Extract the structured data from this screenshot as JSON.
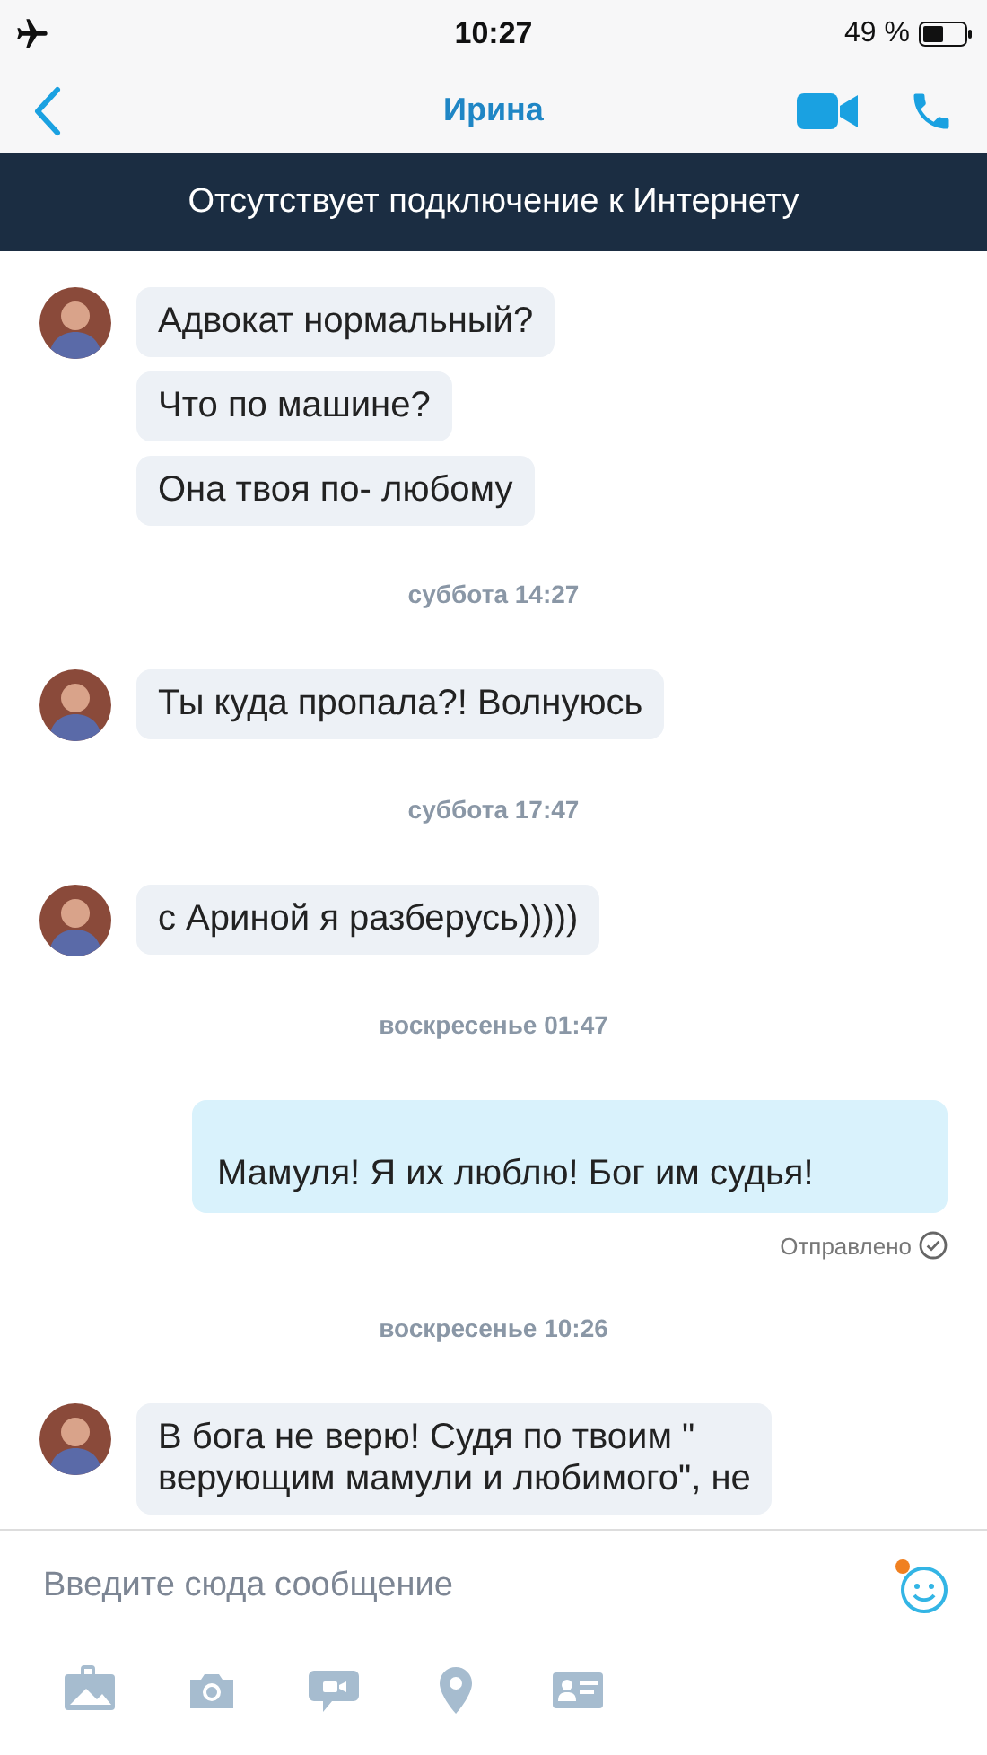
{
  "status_bar": {
    "time": "10:27",
    "battery": "49 %"
  },
  "header": {
    "title": "Ирина"
  },
  "banner": {
    "text": "Отсутствует подключение к Интернету"
  },
  "messages": [
    {
      "kind": "incoming",
      "bubbles": [
        {
          "lines": [
            "Адвокат нормальный?"
          ]
        },
        {
          "lines": [
            "Что по машине?"
          ]
        },
        {
          "lines": [
            "Она твоя по- любому"
          ]
        }
      ]
    },
    {
      "kind": "date",
      "text": "суббота 14:27"
    },
    {
      "kind": "incoming",
      "bubbles": [
        {
          "lines": [
            "Ты куда пропала?! Волнуюсь"
          ]
        }
      ]
    },
    {
      "kind": "date",
      "text": "суббота 17:47"
    },
    {
      "kind": "incoming",
      "bubbles": [
        {
          "lines": [
            "с Ариной я разберусь)))))"
          ]
        }
      ]
    },
    {
      "kind": "date",
      "text": "воскресенье 01:47"
    },
    {
      "kind": "outgoing",
      "text": "Мамуля! Я их люблю! Бог им судья!",
      "status": "Отправлено"
    },
    {
      "kind": "date",
      "text": "воскресенье 10:26"
    },
    {
      "kind": "incoming",
      "bubbles": [
        {
          "lines": [
            "В бога не верю! Судя по твоим \"",
            "верующим мамули и любимого\", не"
          ]
        }
      ]
    }
  ],
  "composer": {
    "placeholder": "Введите сюда сообщение"
  }
}
